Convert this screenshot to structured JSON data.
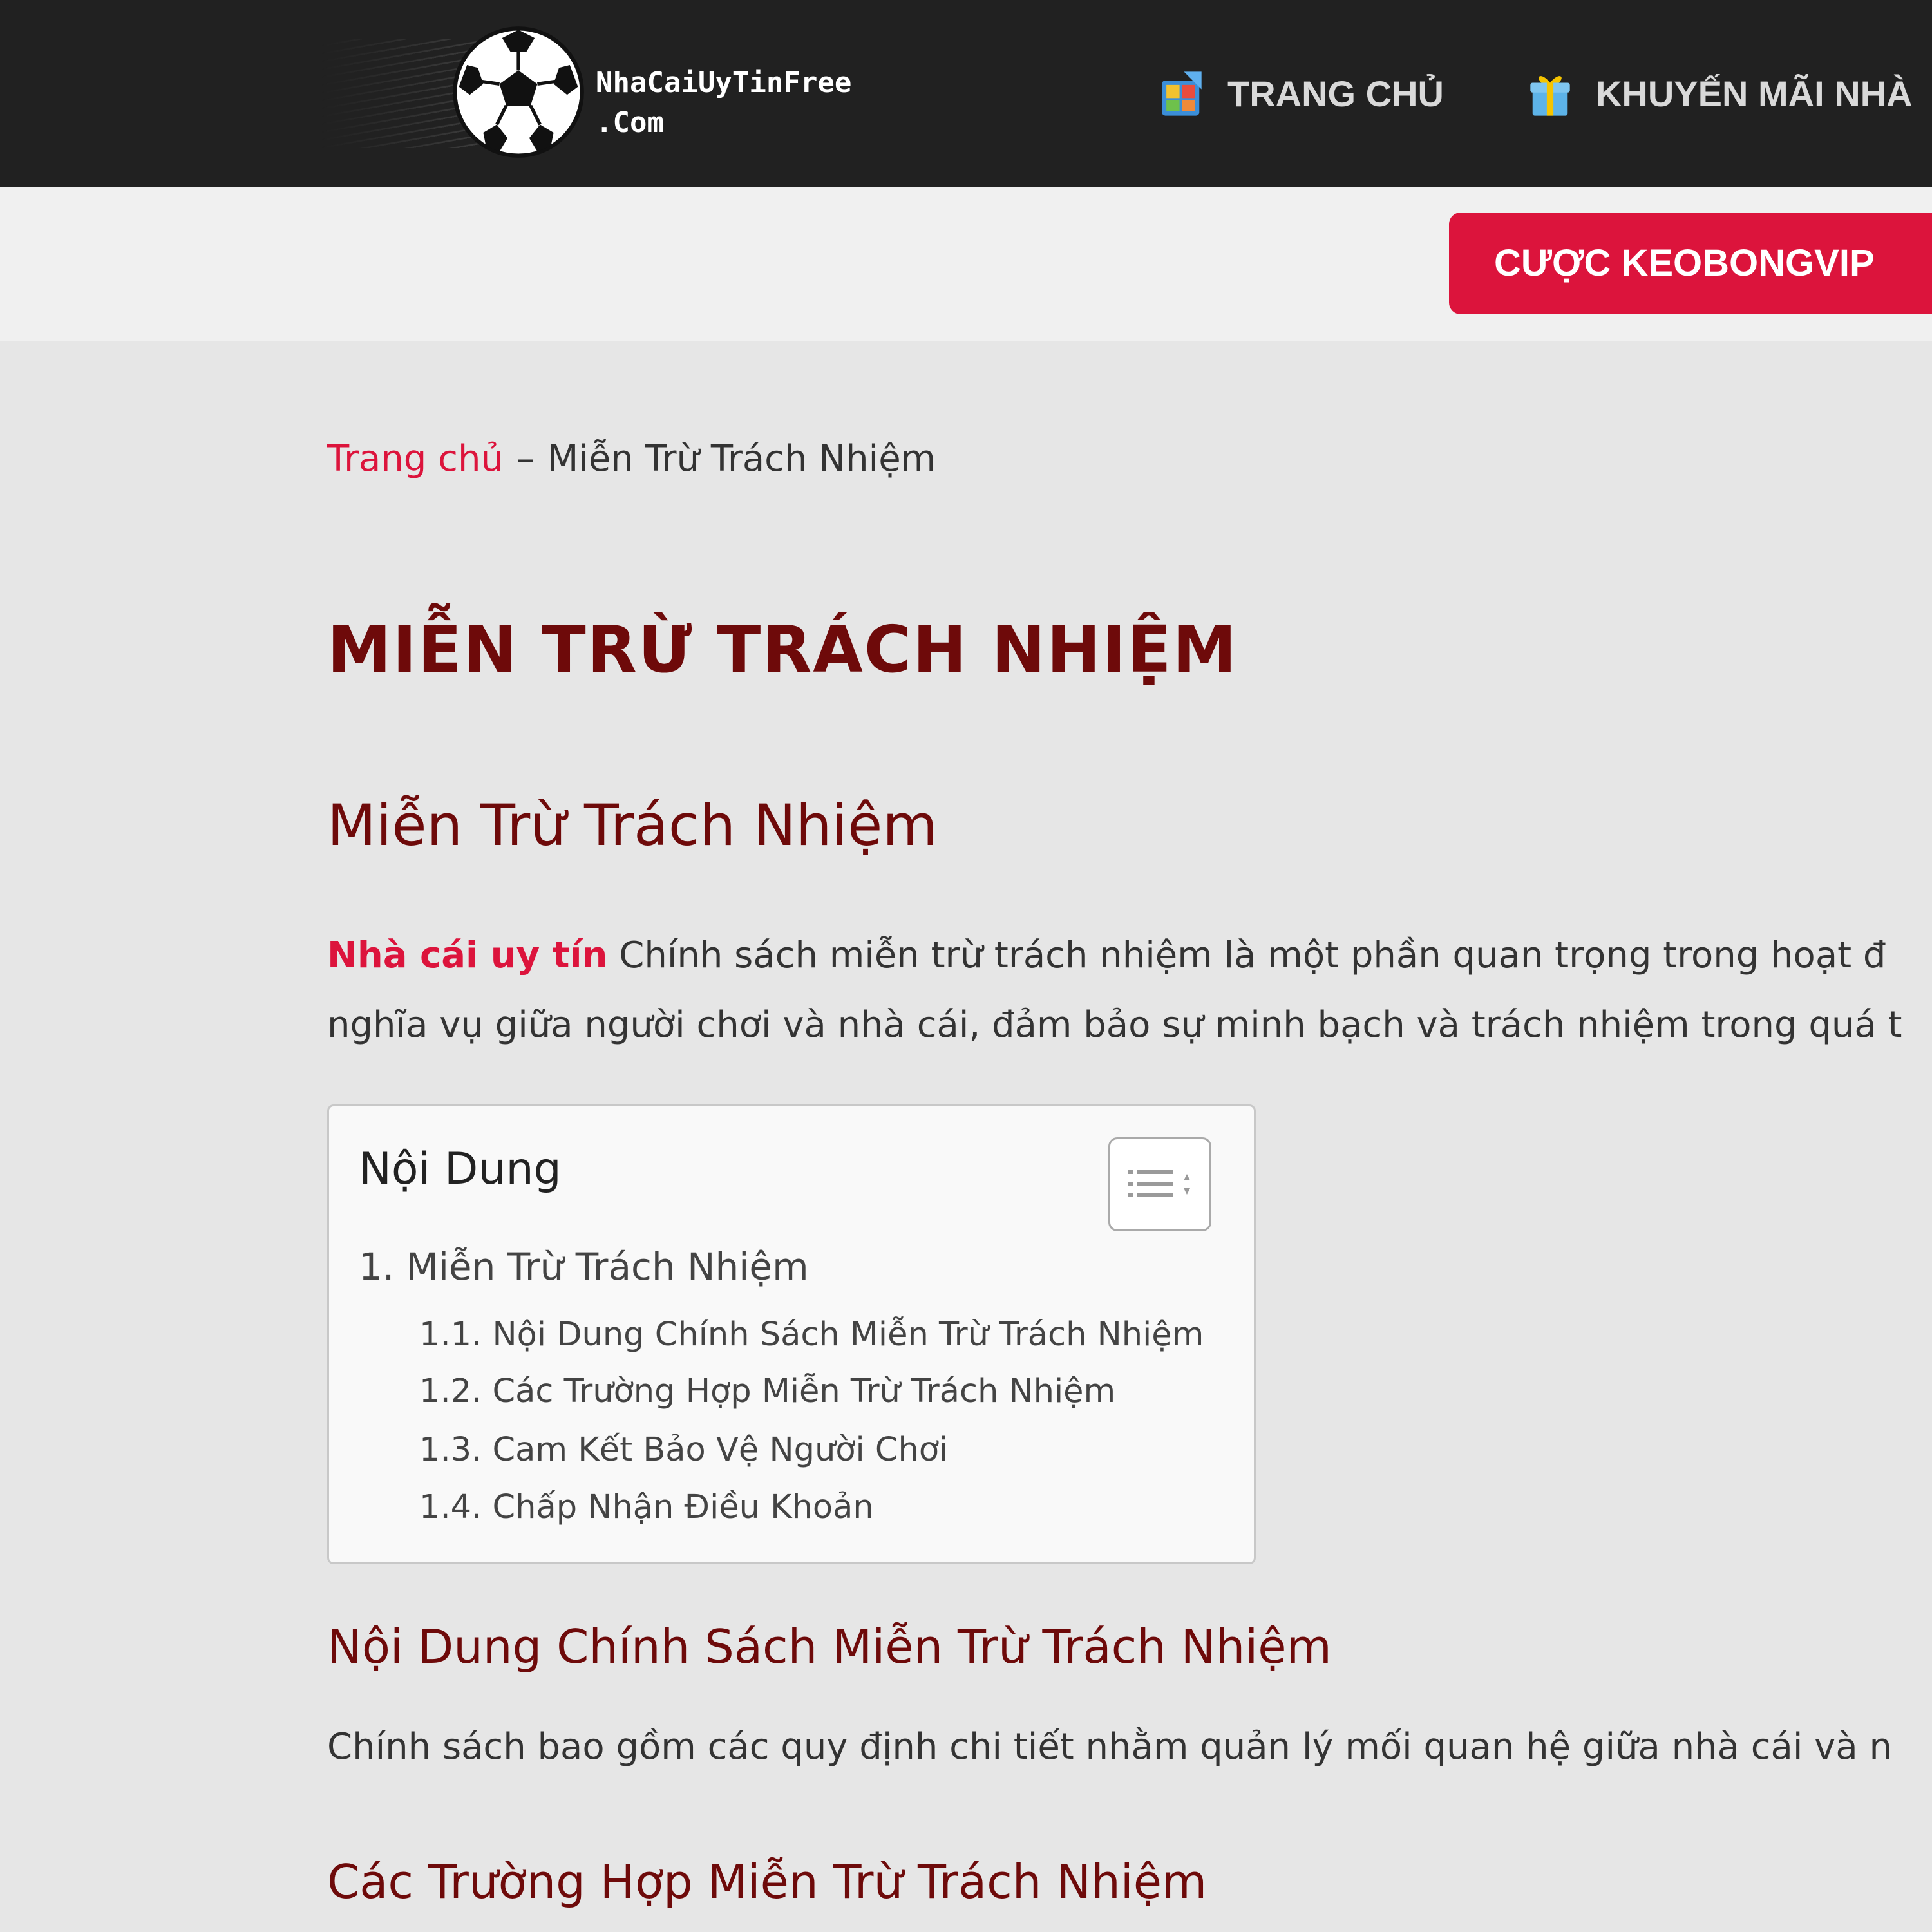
{
  "header": {
    "logo_line1": "NhaCaiUyTinFree",
    "logo_line2": ".Com",
    "nav": [
      {
        "label": "TRANG CHỦ",
        "icon": "home-icon"
      },
      {
        "label": "KHUYẾN MÃI NHÀ",
        "icon": "gift-icon"
      }
    ],
    "cta_label": "CƯỢC KEOBONGVIP"
  },
  "breadcrumb": {
    "home": "Trang chủ",
    "separator": "–",
    "current": "Miễn Trừ Trách Nhiệm"
  },
  "page_title": "MIỄN TRỪ TRÁCH NHIỆM",
  "section_heading": "Miễn Trừ Trách Nhiệm",
  "intro": {
    "link": "Nhà cái uy tín",
    "line1_rest": "Chính sách miễn trừ trách nhiệm là một phần quan trọng trong hoạt đ",
    "line2": "nghĩa vụ giữa người chơi và nhà cái, đảm bảo sự minh bạch và trách nhiệm trong quá t"
  },
  "toc": {
    "title": "Nội Dung",
    "items": [
      {
        "label": "1. Miễn Trừ Trách Nhiệm"
      },
      {
        "label": "1.1. Nội Dung Chính Sách Miễn Trừ Trách Nhiệm"
      },
      {
        "label": "1.2. Các Trường Hợp Miễn Trừ Trách Nhiệm"
      },
      {
        "label": "1.3. Cam Kết Bảo Vệ Người Chơi"
      },
      {
        "label": "1.4. Chấp Nhận Điều Khoản"
      }
    ]
  },
  "sections": [
    {
      "heading": "Nội Dung Chính Sách Miễn Trừ Trách Nhiệm",
      "text": "Chính sách bao gồm các quy định chi tiết nhằm quản lý mối quan hệ giữa nhà cái và n"
    },
    {
      "heading": "Các Trường Hợp Miễn Trừ Trách Nhiệm"
    }
  ],
  "colors": {
    "header_bg": "#212121",
    "accent_red": "#dc143c",
    "heading_maroon": "#6e0a0a",
    "page_bg": "#e6e6e6"
  }
}
